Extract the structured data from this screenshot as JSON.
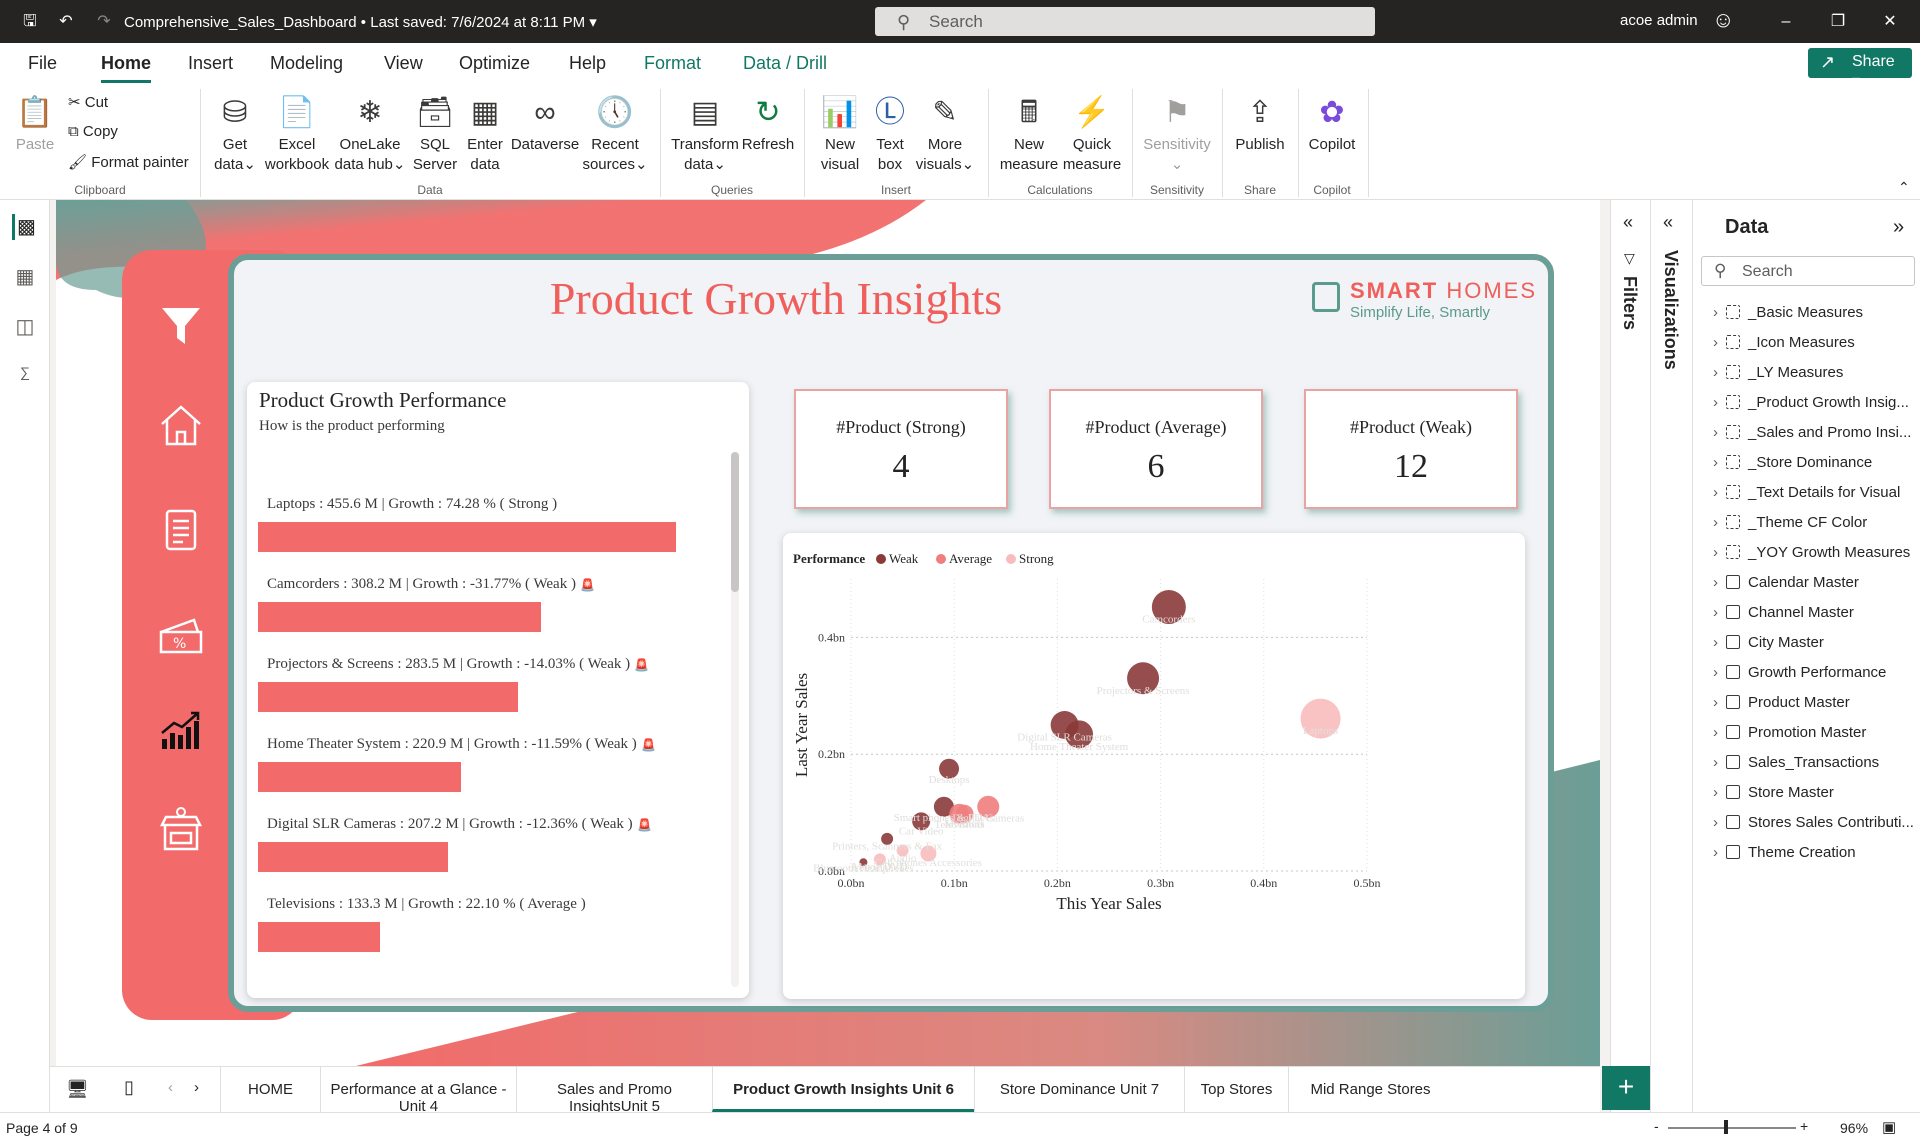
{
  "titlebar": {
    "doc_title": "Comprehensive_Sales_Dashboard",
    "saved": "Last saved: 7/6/2024 at 8:11 PM",
    "search": "Search",
    "user": "acoe admin"
  },
  "ribbon_tabs": [
    "File",
    "Home",
    "Insert",
    "Modeling",
    "View",
    "Optimize",
    "Help",
    "Format",
    "Data / Drill"
  ],
  "share": "Share",
  "ribbon": {
    "paste": "Paste",
    "cut": "Cut",
    "copy": "Copy",
    "format_painter": "Format painter",
    "clipboard": "Clipboard",
    "get_data": [
      "Get",
      "data"
    ],
    "excel": [
      "Excel",
      "workbook"
    ],
    "onelake": [
      "OneLake",
      "data hub"
    ],
    "sql": [
      "SQL",
      "Server"
    ],
    "enter": [
      "Enter",
      "data"
    ],
    "dataverse": "Dataverse",
    "recent": [
      "Recent",
      "sources"
    ],
    "data_group": "Data",
    "transform": [
      "Transform",
      "data"
    ],
    "refresh": "Refresh",
    "queries_group": "Queries",
    "new_visual": [
      "New",
      "visual"
    ],
    "text_box": [
      "Text",
      "box"
    ],
    "more_visuals": [
      "More",
      "visuals"
    ],
    "insert_group": "Insert",
    "new_measure": [
      "New",
      "measure"
    ],
    "quick_measure": [
      "Quick",
      "measure"
    ],
    "calc_group": "Calculations",
    "sensitivity": "Sensitivity",
    "sensitivity_group": "Sensitivity",
    "publish": "Publish",
    "share_group": "Share",
    "copilot": "Copilot",
    "copilot_group": "Copilot"
  },
  "report": {
    "title": "Product Growth Insights",
    "logo_name_bold": "SMART",
    "logo_name_light": "HOMES",
    "logo_tagline": "Simplify Life, Smartly",
    "perf_card": {
      "title": "Product Growth Performance",
      "subtitle": "How is the product performing",
      "items": [
        {
          "label": "Laptops : 455.6 M | Growth : 74.28 % ( Strong )",
          "value": 455.6,
          "alert": false
        },
        {
          "label": "Camcorders : 308.2 M | Growth : -31.77% ( Weak )",
          "value": 308.2,
          "alert": true
        },
        {
          "label": "Projectors & Screens : 283.5 M | Growth : -14.03% ( Weak )",
          "value": 283.5,
          "alert": true
        },
        {
          "label": "Home Theater System : 220.9 M | Growth : -11.59% ( Weak )",
          "value": 220.9,
          "alert": true
        },
        {
          "label": "Digital SLR Cameras : 207.2 M | Growth : -12.36% ( Weak )",
          "value": 207.2,
          "alert": true
        },
        {
          "label": "Televisions : 133.3 M | Growth : 22.10 % ( Average )",
          "value": 133.3,
          "alert": false
        }
      ]
    },
    "kpis": [
      {
        "label": "#Product (Strong)",
        "value": "4"
      },
      {
        "label": "#Product (Average)",
        "value": "6"
      },
      {
        "label": "#Product (Weak)",
        "value": "12"
      }
    ]
  },
  "chart_data": {
    "type": "scatter",
    "legend_title": "Performance",
    "legend": [
      {
        "name": "Weak",
        "color": "#8b3a3a"
      },
      {
        "name": "Average",
        "color": "#f07e7e"
      },
      {
        "name": "Strong",
        "color": "#f9bcbc"
      }
    ],
    "xlabel": "This Year Sales",
    "ylabel": "Last Year Sales",
    "x_ticks": [
      "0.0bn",
      "0.1bn",
      "0.2bn",
      "0.3bn",
      "0.4bn",
      "0.5bn"
    ],
    "y_ticks": [
      "0.0bn",
      "0.2bn",
      "0.4bn"
    ],
    "xlim": [
      0,
      0.5
    ],
    "ylim": [
      0,
      0.5
    ],
    "points": [
      {
        "name": "Camcorders",
        "x": 0.308,
        "y": 0.452,
        "perf": "Weak",
        "r": 17
      },
      {
        "name": "Projectors & Screens",
        "x": 0.283,
        "y": 0.33,
        "perf": "Weak",
        "r": 16
      },
      {
        "name": "Laptops",
        "x": 0.455,
        "y": 0.261,
        "perf": "Strong",
        "r": 20
      },
      {
        "name": "Digital SLR Cameras",
        "x": 0.207,
        "y": 0.25,
        "perf": "Weak",
        "r": 14
      },
      {
        "name": "Home Theater System",
        "x": 0.221,
        "y": 0.234,
        "perf": "Weak",
        "r": 14
      },
      {
        "name": "Desktops",
        "x": 0.095,
        "y": 0.175,
        "perf": "Weak",
        "r": 10
      },
      {
        "name": "Smart phones & PDAs",
        "x": 0.09,
        "y": 0.11,
        "perf": "Weak",
        "r": 10
      },
      {
        "name": "Monitors",
        "x": 0.11,
        "y": 0.098,
        "perf": "Average",
        "r": 9
      },
      {
        "name": "Digital Cameras",
        "x": 0.133,
        "y": 0.11,
        "perf": "Average",
        "r": 11
      },
      {
        "name": "Car Video",
        "x": 0.068,
        "y": 0.085,
        "perf": "Weak",
        "r": 9
      },
      {
        "name": "Televisions",
        "x": 0.105,
        "y": 0.098,
        "perf": "Average",
        "r": 10
      },
      {
        "name": "Printers, Scanners & Fax",
        "x": 0.035,
        "y": 0.055,
        "perf": "Weak",
        "r": 6
      },
      {
        "name": "Movie DVD",
        "x": 0.028,
        "y": 0.02,
        "perf": "Strong",
        "r": 6
      },
      {
        "name": "Cell phones Accessories",
        "x": 0.075,
        "y": 0.03,
        "perf": "Strong",
        "r": 8
      },
      {
        "name": "Audio",
        "x": 0.05,
        "y": 0.035,
        "perf": "Strong",
        "r": 6
      },
      {
        "name": "Bluetooth Headphones",
        "x": 0.012,
        "y": 0.015,
        "perf": "Weak",
        "r": 4
      }
    ]
  },
  "page_tabs": [
    "HOME",
    "Performance at a Glance - Unit 4",
    "Sales and Promo InsightsUnit 5",
    "Product Growth Insights Unit 6",
    "Store Dominance Unit 7",
    "Top Stores",
    "Mid Range Stores"
  ],
  "active_tab": 3,
  "status": {
    "page": "Page 4 of 9",
    "zoom": "96%"
  },
  "side_panes": {
    "filters": "Filters",
    "visualizations": "Visualizations"
  },
  "data_pane": {
    "title": "Data",
    "search": "Search",
    "items": [
      {
        "label": "_Basic Measures",
        "kind": "measure"
      },
      {
        "label": "_Icon Measures",
        "kind": "measure"
      },
      {
        "label": "_LY Measures",
        "kind": "measure"
      },
      {
        "label": "_Product Growth Insig...",
        "kind": "measure"
      },
      {
        "label": "_Sales and Promo Insi...",
        "kind": "measure"
      },
      {
        "label": "_Store Dominance",
        "kind": "measure"
      },
      {
        "label": "_Text Details for Visual",
        "kind": "measure"
      },
      {
        "label": "_Theme CF Color",
        "kind": "measure"
      },
      {
        "label": "_YOY Growth Measures",
        "kind": "measure"
      },
      {
        "label": "Calendar Master",
        "kind": "table"
      },
      {
        "label": "Channel Master",
        "kind": "table"
      },
      {
        "label": "City Master",
        "kind": "table"
      },
      {
        "label": "Growth Performance",
        "kind": "table"
      },
      {
        "label": "Product Master",
        "kind": "table"
      },
      {
        "label": "Promotion Master",
        "kind": "table"
      },
      {
        "label": "Sales_Transactions",
        "kind": "table"
      },
      {
        "label": "Store Master",
        "kind": "table"
      },
      {
        "label": "Stores Sales Contributi...",
        "kind": "table"
      },
      {
        "label": "Theme Creation",
        "kind": "table"
      }
    ]
  }
}
